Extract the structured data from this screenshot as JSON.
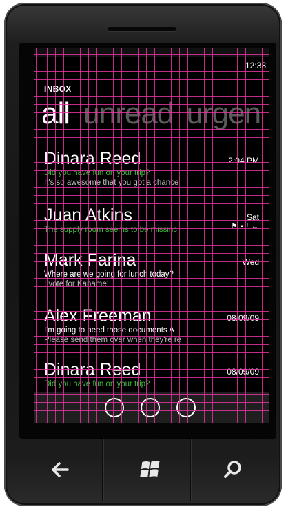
{
  "status": {
    "time": "12:38"
  },
  "header": {
    "title": "INBOX"
  },
  "pivots": [
    {
      "label": "all",
      "active": true
    },
    {
      "label": "unread",
      "active": false
    },
    {
      "label": "urgen",
      "active": false
    }
  ],
  "messages": [
    {
      "sender": "Dinara Reed",
      "subject": "Did you have fun on your trip?",
      "preview": "It's so awesome that you got a chance",
      "date": "2:04 PM",
      "flags": "",
      "unread": true
    },
    {
      "sender": "Juan Atkins",
      "subject": "The supply room seems to be missinc",
      "preview": "",
      "date": "Sat",
      "flags": "⚑ ▪ ! ←",
      "unread": true
    },
    {
      "sender": "Mark Farina",
      "subject": "Where are we going for lunch today?",
      "preview": "I vote for Kaname!",
      "date": "Wed",
      "flags": "",
      "unread": false
    },
    {
      "sender": "Alex Freeman",
      "subject": "I'm going to need those documents A",
      "preview": "Please send them over when they're re",
      "date": "08/09/09",
      "flags": "←",
      "unread": false
    },
    {
      "sender": "Dinara Reed",
      "subject": "Did you have fun on your trip?",
      "preview": "",
      "date": "08/09/09",
      "flags": "",
      "unread": true
    }
  ],
  "appbar": {
    "buttons": [
      "more-1",
      "more-2",
      "more-3"
    ]
  },
  "hardware": {
    "back": "←",
    "start": "⊞",
    "search": "⌕"
  },
  "colors": {
    "accent": "#3fb83f",
    "grid": "#e632a0",
    "background": "#000000"
  }
}
